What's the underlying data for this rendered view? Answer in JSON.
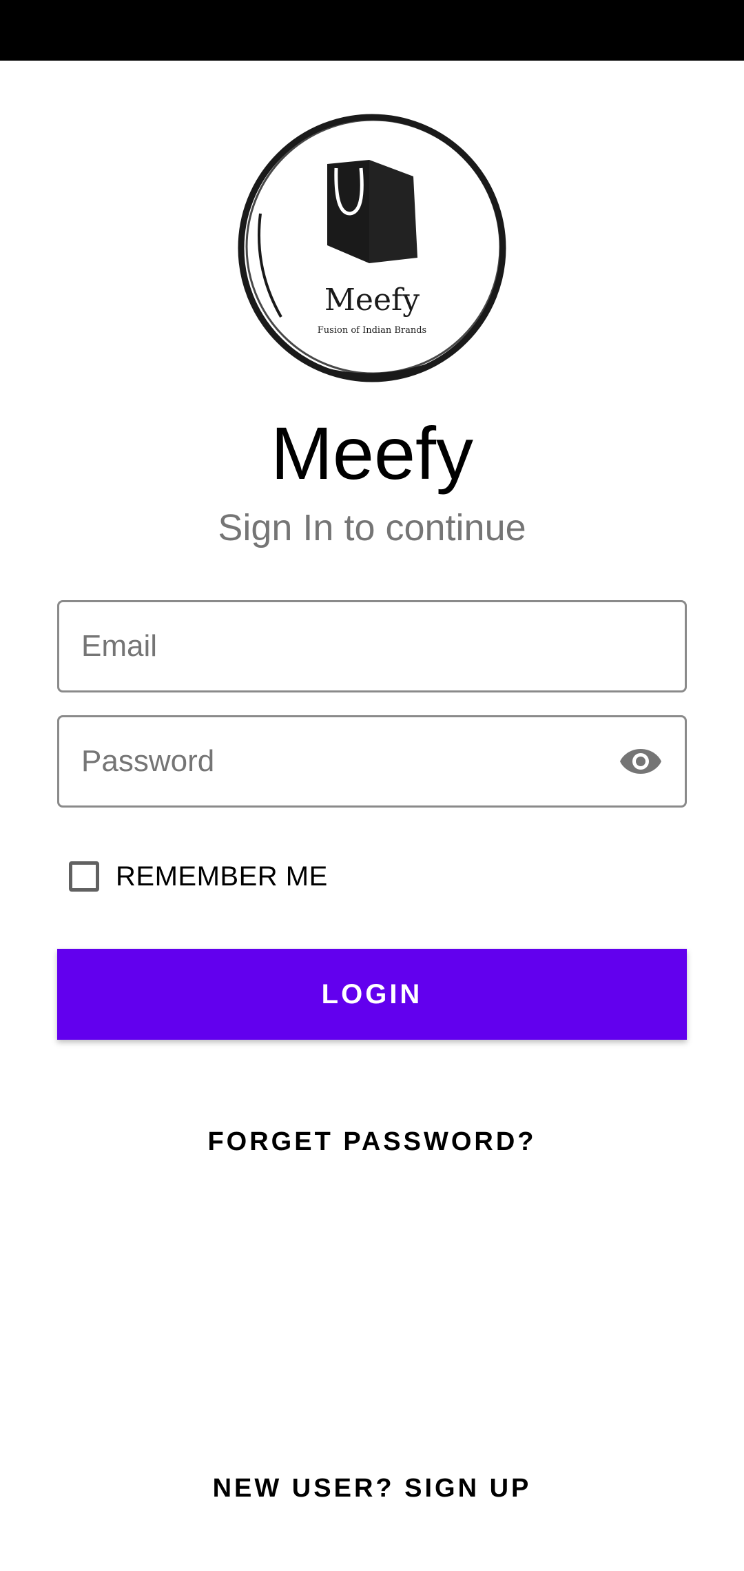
{
  "app": {
    "title": "Meefy",
    "subtitle": "Sign In to continue"
  },
  "logo": {
    "brand": "Meefy",
    "tagline": "Fusion of Indian Brands",
    "icon": "shopping-bag-icon"
  },
  "form": {
    "email_placeholder": "Email",
    "email_value": "",
    "password_placeholder": "Password",
    "password_value": "",
    "password_toggle_icon": "eye-icon",
    "remember_label": "REMEMBER ME",
    "remember_checked": false,
    "login_label": "LOGIN"
  },
  "links": {
    "forget_password": "FORGET PASSWORD?",
    "signup": "NEW USER? SIGN UP"
  },
  "colors": {
    "accent": "#6200ee",
    "status_bar": "#000000"
  }
}
